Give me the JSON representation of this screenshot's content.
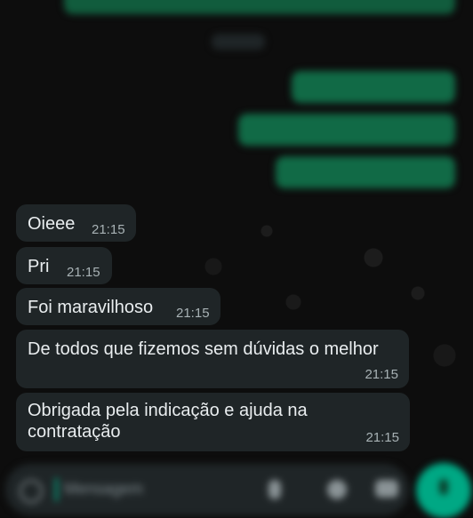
{
  "chat": {
    "date_chip": "",
    "sent_messages": [
      {
        "text": "",
        "time": ""
      },
      {
        "text": "",
        "time": ""
      },
      {
        "text": "",
        "time": ""
      }
    ],
    "received_messages": [
      {
        "text": "Oieee",
        "time": "21:15"
      },
      {
        "text": "Pri",
        "time": "21:15"
      },
      {
        "text": "Foi maravilhoso",
        "time": "21:15"
      },
      {
        "text": "De todos que fizemos sem dúvidas o melhor",
        "time": "21:15"
      },
      {
        "text": "Obrigada pela indicação e ajuda na contratação",
        "time": "21:15"
      }
    ]
  },
  "input": {
    "placeholder": "Mensagem"
  },
  "colors": {
    "background": "#0b0b0b",
    "received_bubble": "#1f2527",
    "sent_bubble": "#116a46",
    "accent": "#00a884",
    "time_text": "#a8b2b5"
  },
  "icons": [
    "emoji-icon",
    "attach-icon",
    "payment-icon",
    "camera-icon",
    "mic-icon"
  ]
}
